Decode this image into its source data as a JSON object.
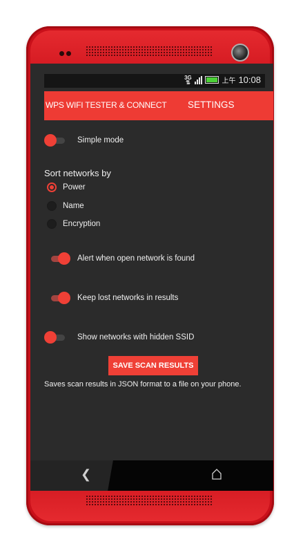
{
  "status_bar": {
    "network": "3G",
    "time_prefix": "上午",
    "time": "10:08"
  },
  "app_bar": {
    "title": "WPS WIFI TESTER & CONNECT",
    "tab": "SETTINGS"
  },
  "settings": {
    "simple_mode": {
      "label": "Simple mode",
      "enabled": false
    },
    "sort": {
      "heading": "Sort networks by",
      "options": [
        "Power",
        "Name",
        "Encryption"
      ],
      "selected": "Power"
    },
    "alert_open": {
      "label": "Alert when open network is found",
      "enabled": true
    },
    "keep_lost": {
      "label": "Keep lost networks in results",
      "enabled": true
    },
    "hidden_ssid": {
      "label": "Show networks with hidden SSID",
      "enabled": false
    }
  },
  "save": {
    "button_label": "SAVE SCAN RESULTS",
    "description": "Saves scan results in JSON format to a file on your phone."
  },
  "colors": {
    "accent": "#ef4036",
    "background": "#2b2b2b",
    "phone_body": "#d21820"
  },
  "nav_icons": [
    "back-icon",
    "home-icon"
  ]
}
